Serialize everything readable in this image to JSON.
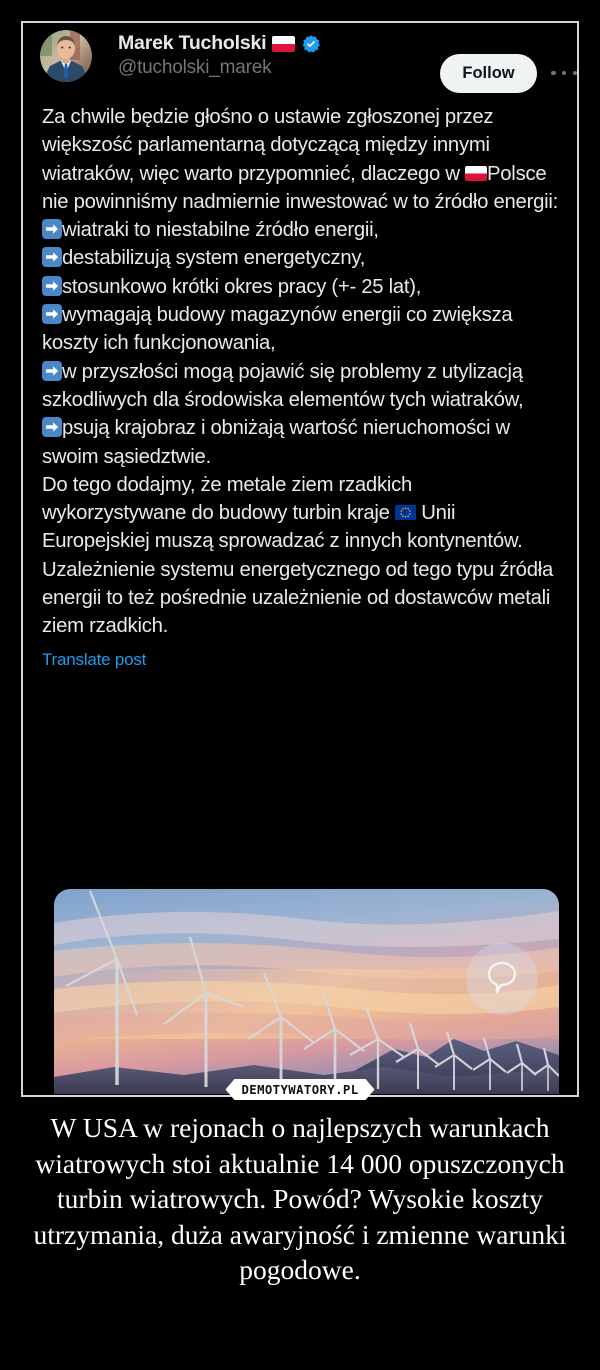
{
  "tweet": {
    "display_name": "Marek Tucholski",
    "handle": "@tucholski_marek",
    "flag_icon": "flag-poland-icon",
    "verified_icon": "verified-badge-icon",
    "follow_label": "Follow",
    "more_label": "More options",
    "translate_label": "Translate post",
    "body_paragraphs": [
      "Za chwile będzie głośno o ustawie zgłoszonej przez większość parlamentarną dotyczącą między innymi wiatraków, więc warto przypomnieć, dlaczego w ",
      "Polsce nie powinniśmy nadmiernie inwestować w to źródło energii:"
    ],
    "bullets": [
      "wiatraki to niestabilne źródło energii,",
      "destabilizują system energetyczny,",
      "stosunkowo krótki okres pracy (+- 25 lat),",
      "wymagają budowy magazynów energii co zwiększa koszty ich funkcjonowania,",
      "w przyszłości mogą pojawić się problemy z utylizacją szkodliwych dla środowiska elementów tych wiatraków,",
      "psują krajobraz i obniżają wartość nieruchomości w swoim sąsiedztwie."
    ],
    "closing_part_1": "Do tego dodajmy, że metale ziem rzadkich wykorzystywane do budowy turbin kraje ",
    "closing_part_2": " Unii Europejskiej muszą sprowadzać z innych kontynentów. Uzależnienie systemu energetycznego od tego typu źródła energii to też pośrednie uzależnienie od dostawców metali ziem rzadkich.",
    "media_alt": "wind-turbines-at-sunset-photo",
    "reply_icon": "speech-bubble-icon"
  },
  "watermark": {
    "text": "DEMOTYWATORY.PL"
  },
  "caption": {
    "text": "W USA w rejonach o najlepszych warunkach wiatrowych stoi aktualnie 14 000 opuszczonych turbin wiatrowych. Powód? Wysokie koszty utrzymania, duża awaryjność i zmienne warunki pogodowe."
  },
  "colors": {
    "background": "#000000",
    "card_border": "#cfd6dc",
    "text_primary": "#e7e9ea",
    "text_muted": "#71767b",
    "link": "#1d9bf0",
    "follow_bg": "#eff3f4",
    "verified_blue": "#1d9bf0",
    "emoji_arrow_blue": "#4a86c8",
    "eu_blue": "#003399",
    "eu_star_yellow": "#ffcc00",
    "flag_red": "#dc143c"
  }
}
